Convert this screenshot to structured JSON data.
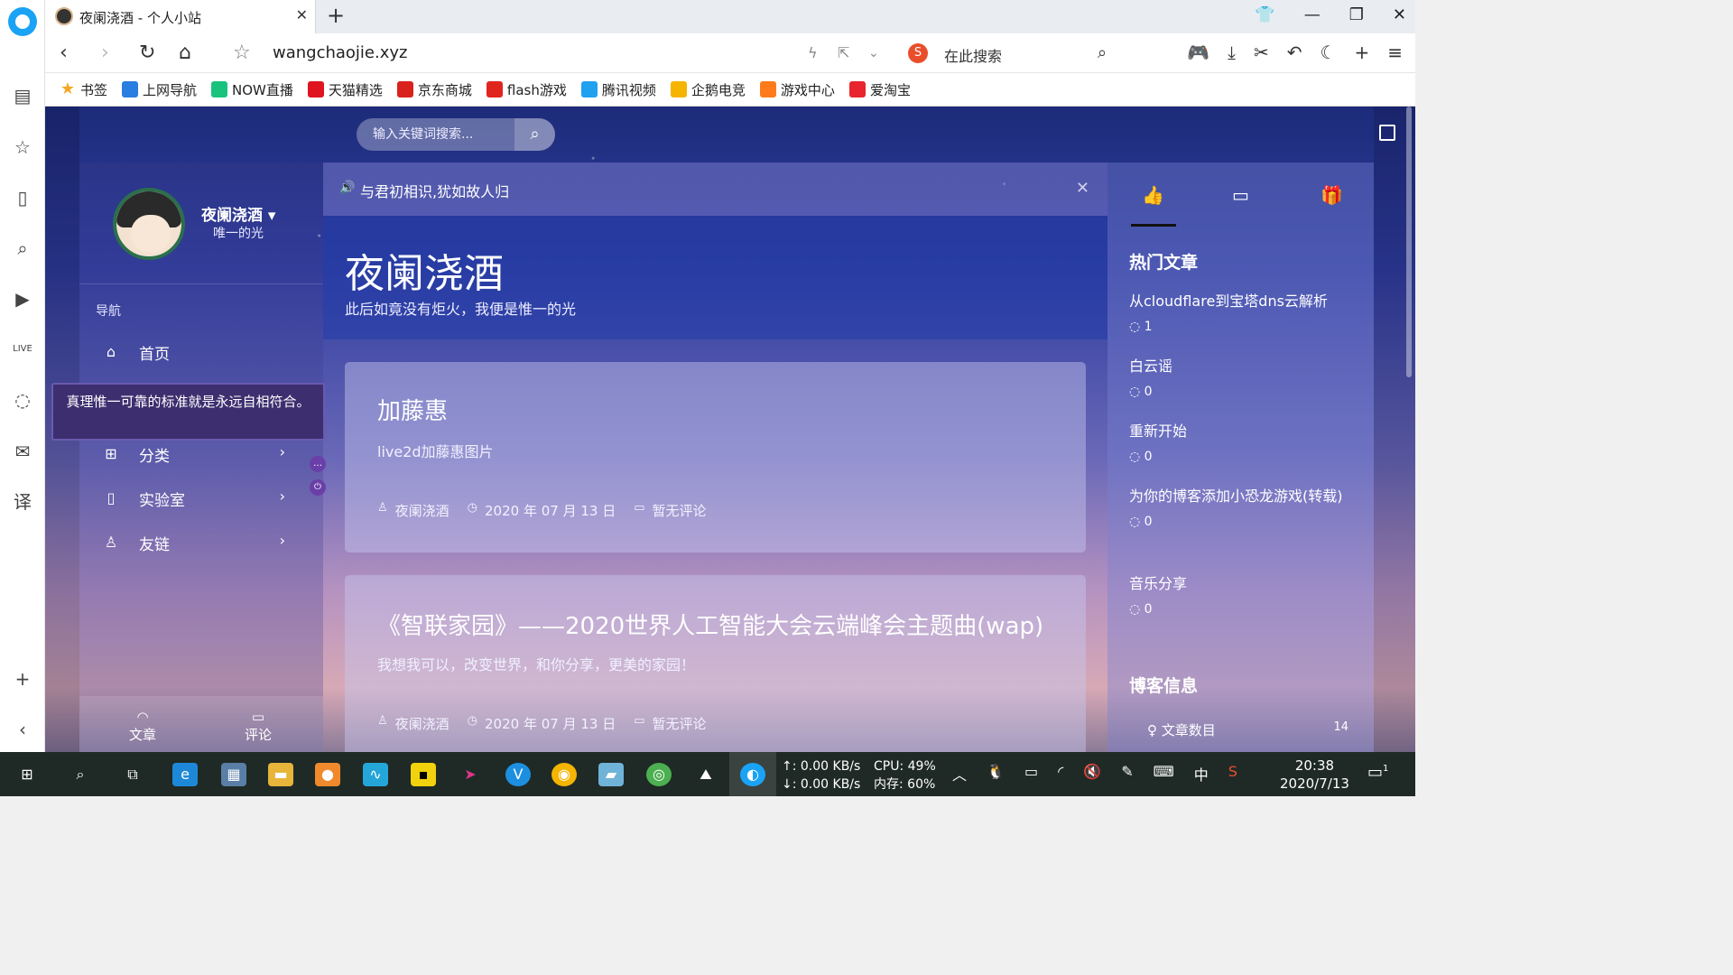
{
  "browser": {
    "tab_title": "夜阑浇酒 - 个人小站",
    "url": "wangchaojie.xyz",
    "search_placeholder": "在此搜索",
    "bookmarks": [
      {
        "label": "书签",
        "color": "#f5a623",
        "icon": "star-icon"
      },
      {
        "label": "上网导航",
        "color": "#2a7de1",
        "icon": "e-icon"
      },
      {
        "label": "NOW直播",
        "color": "#19c37d",
        "icon": "now-icon"
      },
      {
        "label": "天猫精选",
        "color": "#e0141e",
        "icon": "tmall-icon"
      },
      {
        "label": "京东商城",
        "color": "#d9221b",
        "icon": "jd-icon"
      },
      {
        "label": "flash游戏",
        "color": "#e0251f",
        "icon": "flash-icon"
      },
      {
        "label": "腾讯视频",
        "color": "#1fa1f0",
        "icon": "play-icon"
      },
      {
        "label": "企鹅电竞",
        "color": "#f5b400",
        "icon": "penguin-icon"
      },
      {
        "label": "游戏中心",
        "color": "#ff7a1a",
        "icon": "game-icon"
      },
      {
        "label": "爱淘宝",
        "color": "#e8242c",
        "icon": "taobao-icon"
      }
    ]
  },
  "site": {
    "search_placeholder": "输入关键词搜索...",
    "user": {
      "name": "夜阑浇酒",
      "subtitle": "唯一的光"
    },
    "nav_heading": "导航",
    "nav": [
      {
        "label": "首页",
        "icon": "home-icon",
        "has_arrow": false
      },
      {
        "label": "分类",
        "icon": "grid-icon",
        "has_arrow": true
      },
      {
        "label": "实验室",
        "icon": "file-icon",
        "has_arrow": true
      },
      {
        "label": "友链",
        "icon": "user-icon",
        "has_arrow": true
      }
    ],
    "tooltip": "真理惟一可靠的标准就是永远自相符合。",
    "bottom_tabs": [
      "文章",
      "评论"
    ],
    "notice": "与君初相识,犹如故人归",
    "banner_title": "夜阑浇酒",
    "banner_subtitle": "此后如竟没有炬火，我便是惟一的光",
    "posts": [
      {
        "title": "加藤惠",
        "desc": "live2d加藤惠图片",
        "author": "夜阑浇酒",
        "date": "2020 年 07 月 13 日",
        "comments": "暂无评论"
      },
      {
        "title": "《智联家园》——2020世界人工智能大会云端峰会主题曲(wap)",
        "desc": "我想我可以，改变世界，和你分享，更美的家园！",
        "author": "夜阑浇酒",
        "date": "2020 年 07 月 13 日",
        "comments": "暂无评论"
      }
    ],
    "hot_heading": "热门文章",
    "hot": [
      {
        "title": "从cloudflare到宝塔dns云解析",
        "count": "1"
      },
      {
        "title": "白云谣",
        "count": "0"
      },
      {
        "title": "重新开始",
        "count": "0"
      },
      {
        "title": "为你的博客添加小恐龙游戏(转载)",
        "count": "0"
      },
      {
        "title": "音乐分享",
        "count": "0"
      }
    ],
    "info_heading": "博客信息",
    "info_label": "文章数目",
    "info_count": "14"
  },
  "taskbar": {
    "net_up": "↑: 0.00 KB/s",
    "net_down": "↓: 0.00 KB/s",
    "cpu": "CPU: 49%",
    "mem": "内存: 60%",
    "ime": "中",
    "time": "20:38",
    "date": "2020/7/13",
    "notifications": "1"
  }
}
